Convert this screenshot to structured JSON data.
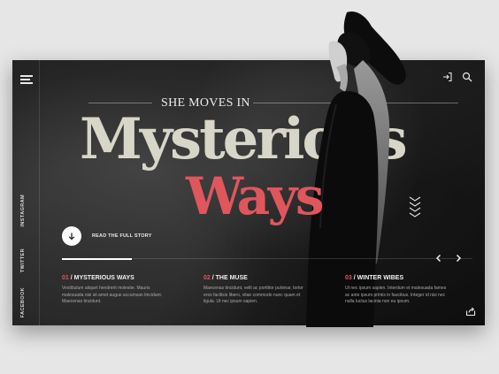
{
  "sidebar": {
    "social_links": [
      "INSTAGRAM",
      "TWITTER",
      "FACEBOOK"
    ]
  },
  "hero": {
    "eyebrow": "SHE MOVES IN",
    "title_line1": "Mysterious",
    "title_line2": "Ways",
    "cta_label": "READ THE FULL STORY"
  },
  "progress": {
    "value": 0.17
  },
  "stories": [
    {
      "number": "01",
      "title": "MYSTERIOUS WAYS",
      "text": "Vestibulum aliquet hendrerit molestie. Mauris malesuada nisi sit amet augue accumsan tincidunt. Maecenas tincidunt."
    },
    {
      "number": "02",
      "title": "THE MUSE",
      "text": "Maecenas tincidunt, velit ac porttitor pulvinar, tortor eros facilisis libero, vitae commodo nunc quam et ligula. Ut nec ipsum sapien."
    },
    {
      "number": "03",
      "title": "WINTER WIBES",
      "text": "Ut nec ipsum sapien. Interdum et malesuada fames ac ante ipsum primis in faucibus. Integer id nisi nec nulla luctus lacinia non eu ipsum."
    }
  ],
  "colors": {
    "accent": "#e0565d",
    "title_light": "#d8d6c8",
    "background": "#e6e6e6",
    "card": "#262626"
  },
  "icons": {
    "menu": "menu-icon",
    "login": "login-icon",
    "search": "search-icon",
    "cta": "arrow-down-icon",
    "decor": "zigzag-icon",
    "prev": "chevron-left-icon",
    "next": "chevron-right-icon",
    "share": "share-icon"
  }
}
